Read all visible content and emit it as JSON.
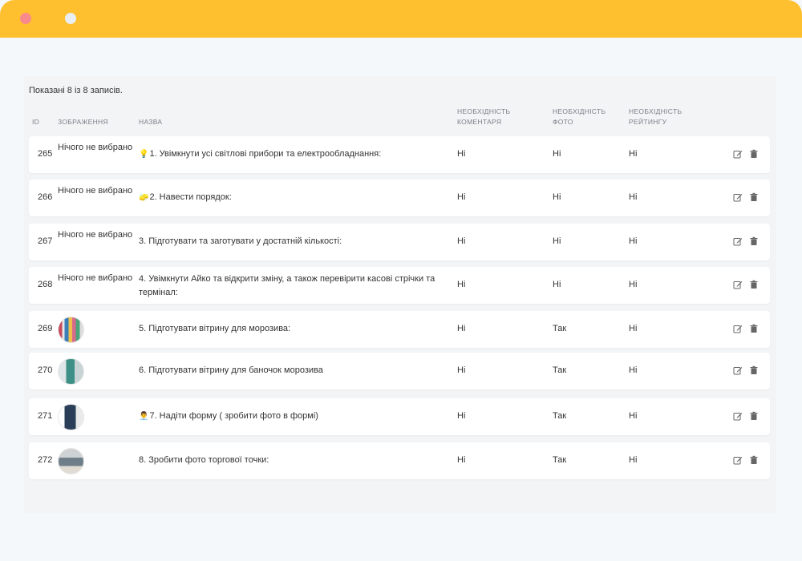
{
  "window": {
    "accent": "#ffc02f"
  },
  "summary": "Показані 8 із 8 записів.",
  "columns": {
    "id": "ID",
    "image": "ЗОБРАЖЕННЯ",
    "name": "НАЗВА",
    "comment": "НЕОБХІДНІСТЬ КОМЕНТАРЯ",
    "photo": "НЕОБХІДНІСТЬ ФОТО",
    "rating": "НЕОБХІДНІСТЬ РЕЙТИНГУ"
  },
  "rows": [
    {
      "id": "265",
      "image_text": "Нічого не вибрано",
      "icon": "💡",
      "name": "1. Увімкнути усі світлові прибори та електрообладнання:",
      "comment": "Ні",
      "photo": "Ні",
      "rating": "Ні"
    },
    {
      "id": "266",
      "image_text": "Нічого не вибрано",
      "icon": "🧽",
      "name": "2. Навести порядок:",
      "comment": "Ні",
      "photo": "Ні",
      "rating": "Ні"
    },
    {
      "id": "267",
      "image_text": "Нічого не вибрано",
      "icon": "",
      "name": "3. Підготувати та заготувати у достатній кількості:",
      "comment": "Ні",
      "photo": "Ні",
      "rating": "Ні"
    },
    {
      "id": "268",
      "image_text": "Нічого не вибрано",
      "icon": "",
      "name": "4. Увімкнути Айко та відкрити зміну, а також перевірити касові стрічки та термінал:",
      "comment": "Ні",
      "photo": "Ні",
      "rating": "Ні"
    },
    {
      "id": "269",
      "image_text": "",
      "icon": "",
      "name": "5. Підготувати вітрину для морозива:",
      "comment": "Ні",
      "photo": "Так",
      "rating": "Ні"
    },
    {
      "id": "270",
      "image_text": "",
      "icon": "",
      "name": "6. Підготувати вітрину для баночок морозива",
      "comment": "Ні",
      "photo": "Так",
      "rating": "Ні"
    },
    {
      "id": "271",
      "image_text": "",
      "icon": "👨‍💼",
      "name": "7. Надіти форму ( зробити фото в формі)",
      "comment": "Ні",
      "photo": "Так",
      "rating": "Ні"
    },
    {
      "id": "272",
      "image_text": "",
      "icon": "",
      "name": "8. Зробити фото торгової точки:",
      "comment": "Ні",
      "photo": "Так",
      "rating": "Ні"
    }
  ],
  "icons": {
    "edit": "edit-icon",
    "delete": "trash-icon"
  }
}
